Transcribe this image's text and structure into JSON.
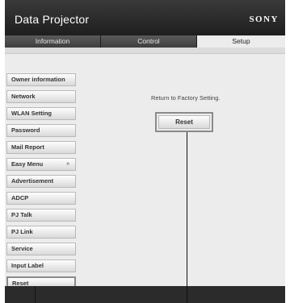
{
  "header": {
    "app_title": "Data Projector",
    "brand": "SONY"
  },
  "tabs": [
    {
      "label": "Information"
    },
    {
      "label": "Control"
    },
    {
      "label": "Setup"
    }
  ],
  "sidebar": {
    "items": [
      {
        "label": "Owner information"
      },
      {
        "label": "Network"
      },
      {
        "label": "WLAN Setting"
      },
      {
        "label": "Password"
      },
      {
        "label": "Mail Report"
      },
      {
        "label": "Easy Menu",
        "chevron": "double-chevron-up-icon"
      },
      {
        "label": "Advertisement"
      },
      {
        "label": "ADCP"
      },
      {
        "label": "PJ Talk"
      },
      {
        "label": "PJ Link"
      },
      {
        "label": "Service"
      },
      {
        "label": "Input Label"
      },
      {
        "label": "Reset"
      }
    ],
    "active_label": "Reset"
  },
  "main": {
    "message": "Return to Factory Setting.",
    "reset_button_label": "Reset"
  },
  "colors": {
    "frame": "#2b2b2b",
    "tab_inactive": "#4a4a4a",
    "tab_active": "#ececec",
    "content_bg": "#ececec"
  }
}
